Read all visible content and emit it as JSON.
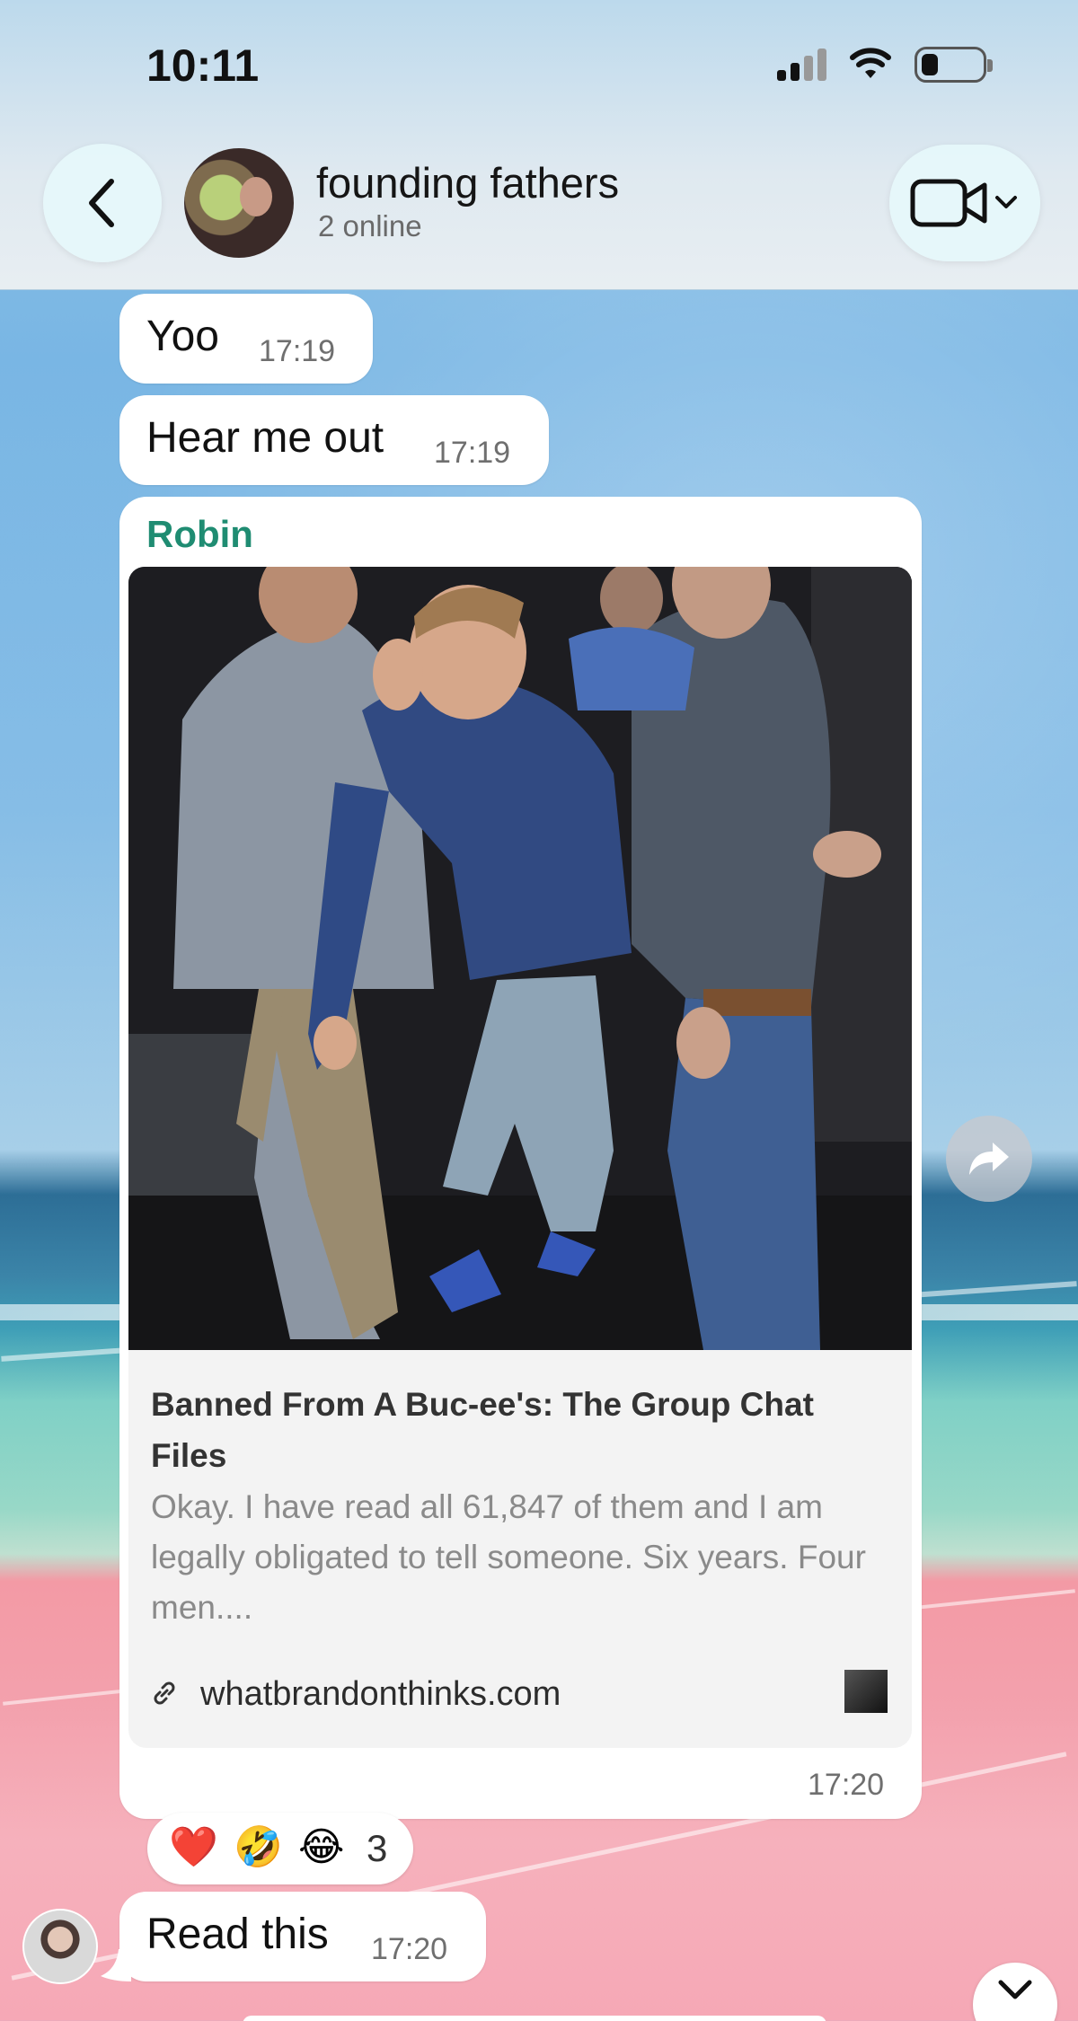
{
  "status_bar": {
    "time": "10:11"
  },
  "header": {
    "title": "founding fathers",
    "subtitle": "2 online",
    "back_icon": "chevron-left-icon",
    "video_icon": "video-camera-icon"
  },
  "messages": [
    {
      "text": "Yoo",
      "time": "17:19"
    },
    {
      "text": "Hear me out",
      "time": "17:19"
    },
    {
      "sender": "Robin",
      "link_preview": {
        "title": "Banned From A Buc-ee's: The Group Chat Files",
        "description": "Okay. I have read all 61,847 of them and I am legally obligated to tell someone. Six years. Four men....",
        "domain": "whatbrandonthinks.com"
      },
      "time": "17:20",
      "reactions": {
        "emojis": [
          "❤️",
          "🤣",
          "😂"
        ],
        "count": "3"
      }
    },
    {
      "text": "Read this",
      "time": "17:20"
    }
  ],
  "colors": {
    "sender_name": "#1f8c72",
    "bubble": "#ffffff",
    "header_bg": "#e4ecf1",
    "heart": "#e0242d"
  }
}
